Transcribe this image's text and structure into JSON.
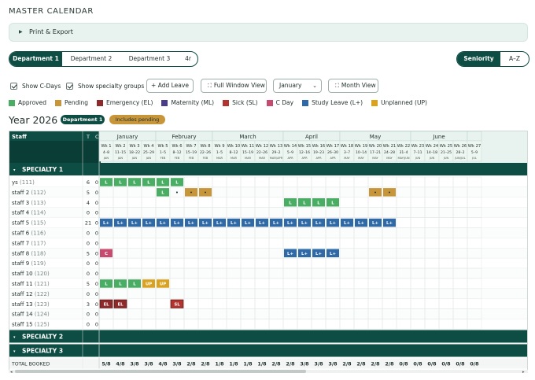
{
  "title": "MASTER CALENDAR",
  "print_export": "Print & Export",
  "dept_tabs": [
    "Department 1",
    "Department 2",
    "Department 3",
    "4r"
  ],
  "sort_tabs": [
    "Seniority",
    "A–Z"
  ],
  "controls": {
    "show_c_days": "Show C-Days",
    "show_specialty": "Show specialty groups",
    "add_leave": "+ Add Leave",
    "full_window": "Full Window View",
    "month_select": "January",
    "month_view": "Month View"
  },
  "legend": [
    {
      "label": "Approved",
      "color": "#4aad64"
    },
    {
      "label": "Pending",
      "color": "#c8963a"
    },
    {
      "label": "Emergency (EL)",
      "color": "#8e2a2a"
    },
    {
      "label": "Maternity (ML)",
      "color": "#4b3d8a"
    },
    {
      "label": "Sick (SL)",
      "color": "#b2342f"
    },
    {
      "label": "C Day",
      "color": "#c64b6e"
    },
    {
      "label": "Study Leave (L+)",
      "color": "#2f6aa7"
    },
    {
      "label": "Unplanned (UP)",
      "color": "#d9a21f"
    }
  ],
  "year_title": "Year 2026",
  "badge_dept": "Department 1",
  "badge_pending": "Includes pending",
  "table": {
    "staff_header": "Staff",
    "t_header": "T",
    "c_header": "C",
    "months": [
      {
        "name": "January",
        "start": 0,
        "span": 4
      },
      {
        "name": "February",
        "start": 4,
        "span": 4
      },
      {
        "name": "March",
        "start": 8,
        "span": 5
      },
      {
        "name": "April",
        "start": 13,
        "span": 4
      },
      {
        "name": "May",
        "start": 17,
        "span": 5
      },
      {
        "name": "June",
        "start": 22,
        "span": 4
      },
      {
        "name": "",
        "start": 26,
        "span": 1
      }
    ],
    "weeks": [
      {
        "wk": "Wk 1",
        "dates": "4–8",
        "mon": "JAN"
      },
      {
        "wk": "Wk 2",
        "dates": "11–15",
        "mon": "JAN"
      },
      {
        "wk": "Wk 3",
        "dates": "18–22",
        "mon": "JAN"
      },
      {
        "wk": "Wk 4",
        "dates": "25–29",
        "mon": "JAN"
      },
      {
        "wk": "Wk 5",
        "dates": "1–5",
        "mon": "FEB"
      },
      {
        "wk": "Wk 6",
        "dates": "8–12",
        "mon": "FEB"
      },
      {
        "wk": "Wk 7",
        "dates": "15–19",
        "mon": "FEB"
      },
      {
        "wk": "Wk 8",
        "dates": "22–26",
        "mon": "FEB"
      },
      {
        "wk": "Wk 9",
        "dates": "1–5",
        "mon": "MAR"
      },
      {
        "wk": "Wk 10",
        "dates": "8–12",
        "mon": "MAR"
      },
      {
        "wk": "Wk 11",
        "dates": "15–19",
        "mon": "MAR"
      },
      {
        "wk": "Wk 12",
        "dates": "22–26",
        "mon": "MAR"
      },
      {
        "wk": "Wk 13",
        "dates": "29–2",
        "mon": "MAR/APR"
      },
      {
        "wk": "Wk 14",
        "dates": "5–9",
        "mon": "APR"
      },
      {
        "wk": "Wk 15",
        "dates": "12–16",
        "mon": "APR"
      },
      {
        "wk": "Wk 16",
        "dates": "19–23",
        "mon": "APR"
      },
      {
        "wk": "Wk 17",
        "dates": "26–30",
        "mon": "APR"
      },
      {
        "wk": "Wk 18",
        "dates": "3–7",
        "mon": "MAY"
      },
      {
        "wk": "Wk 19",
        "dates": "10–14",
        "mon": "MAY"
      },
      {
        "wk": "Wk 20",
        "dates": "17–21",
        "mon": "MAY"
      },
      {
        "wk": "Wk 21",
        "dates": "24–28",
        "mon": "MAY"
      },
      {
        "wk": "Wk 22",
        "dates": "31–4",
        "mon": "MAY/JUN"
      },
      {
        "wk": "Wk 23",
        "dates": "7–11",
        "mon": "JUN"
      },
      {
        "wk": "Wk 24",
        "dates": "14–18",
        "mon": "JUN"
      },
      {
        "wk": "Wk 25",
        "dates": "21–25",
        "mon": "JUN"
      },
      {
        "wk": "Wk 26",
        "dates": "28–2",
        "mon": "JUN/JUL"
      },
      {
        "wk": "Wk 27",
        "dates": "5–9",
        "mon": "JUL"
      }
    ],
    "specialty_1": "SPECIALTY 1",
    "specialty_2": "SPECIALTY 2",
    "specialty_3": "SPECIALTY 3",
    "staff": [
      {
        "name": "ys",
        "id": "(111)",
        "t": "6",
        "c": "0",
        "cells": [
          {
            "w": 0,
            "k": "L",
            "c": "approved"
          },
          {
            "w": 1,
            "k": "L",
            "c": "approved"
          },
          {
            "w": 2,
            "k": "L",
            "c": "approved"
          },
          {
            "w": 3,
            "k": "L",
            "c": "approved"
          },
          {
            "w": 4,
            "k": "L",
            "c": "approved"
          },
          {
            "w": 5,
            "k": "L",
            "c": "approved"
          }
        ]
      },
      {
        "name": "staff 2",
        "id": "(112)",
        "t": "5",
        "c": "0",
        "cells": [
          {
            "w": 4,
            "k": "L",
            "c": "approved"
          },
          {
            "w": 5,
            "k": "•",
            "c": "dot"
          },
          {
            "w": 6,
            "k": "•",
            "c": "pending"
          },
          {
            "w": 7,
            "k": "•",
            "c": "pending"
          },
          {
            "w": 19,
            "k": "•",
            "c": "pending"
          },
          {
            "w": 20,
            "k": "•",
            "c": "pending"
          }
        ]
      },
      {
        "name": "staff 3",
        "id": "(113)",
        "t": "4",
        "c": "0",
        "cells": [
          {
            "w": 13,
            "k": "L",
            "c": "approved"
          },
          {
            "w": 14,
            "k": "L",
            "c": "approved"
          },
          {
            "w": 15,
            "k": "L",
            "c": "approved"
          },
          {
            "w": 16,
            "k": "L",
            "c": "approved"
          }
        ]
      },
      {
        "name": "staff 4",
        "id": "(114)",
        "t": "0",
        "c": "0",
        "cells": []
      },
      {
        "name": "staff 5",
        "id": "(115)",
        "t": "21",
        "c": "0",
        "cells": [
          {
            "w": 0,
            "k": "L+",
            "c": "study"
          },
          {
            "w": 1,
            "k": "L+",
            "c": "study"
          },
          {
            "w": 2,
            "k": "L+",
            "c": "study"
          },
          {
            "w": 3,
            "k": "L+",
            "c": "study"
          },
          {
            "w": 4,
            "k": "L+",
            "c": "study"
          },
          {
            "w": 5,
            "k": "L+",
            "c": "study"
          },
          {
            "w": 6,
            "k": "L+",
            "c": "study"
          },
          {
            "w": 7,
            "k": "L+",
            "c": "study"
          },
          {
            "w": 8,
            "k": "L+",
            "c": "study"
          },
          {
            "w": 9,
            "k": "L+",
            "c": "study"
          },
          {
            "w": 10,
            "k": "L+",
            "c": "study"
          },
          {
            "w": 11,
            "k": "L+",
            "c": "study"
          },
          {
            "w": 12,
            "k": "L+",
            "c": "study"
          },
          {
            "w": 13,
            "k": "L+",
            "c": "study"
          },
          {
            "w": 14,
            "k": "L+",
            "c": "study"
          },
          {
            "w": 15,
            "k": "L+",
            "c": "study"
          },
          {
            "w": 16,
            "k": "L+",
            "c": "study"
          },
          {
            "w": 17,
            "k": "L+",
            "c": "study"
          },
          {
            "w": 18,
            "k": "L+",
            "c": "study"
          },
          {
            "w": 19,
            "k": "L+",
            "c": "study"
          },
          {
            "w": 20,
            "k": "L+",
            "c": "study"
          }
        ]
      },
      {
        "name": "staff 6",
        "id": "(116)",
        "t": "0",
        "c": "0",
        "cells": []
      },
      {
        "name": "staff 7",
        "id": "(117)",
        "t": "0",
        "c": "0",
        "cells": []
      },
      {
        "name": "staff 8",
        "id": "(118)",
        "t": "5",
        "c": "0",
        "cells": [
          {
            "w": 0,
            "k": "C",
            "c": "cday"
          },
          {
            "w": 13,
            "k": "L+",
            "c": "study"
          },
          {
            "w": 14,
            "k": "L+",
            "c": "study"
          },
          {
            "w": 15,
            "k": "L+",
            "c": "study"
          },
          {
            "w": 16,
            "k": "L+",
            "c": "study"
          }
        ]
      },
      {
        "name": "staff 9",
        "id": "(119)",
        "t": "0",
        "c": "0",
        "cells": []
      },
      {
        "name": "staff 10",
        "id": "(120)",
        "t": "0",
        "c": "0",
        "cells": []
      },
      {
        "name": "staff 11",
        "id": "(121)",
        "t": "5",
        "c": "0",
        "cells": [
          {
            "w": 0,
            "k": "L",
            "c": "approved"
          },
          {
            "w": 1,
            "k": "L",
            "c": "approved"
          },
          {
            "w": 2,
            "k": "L",
            "c": "approved"
          },
          {
            "w": 3,
            "k": "UP",
            "c": "unplanned"
          },
          {
            "w": 4,
            "k": "UP",
            "c": "unplanned"
          }
        ]
      },
      {
        "name": "staff 12",
        "id": "(122)",
        "t": "0",
        "c": "0",
        "cells": []
      },
      {
        "name": "staff 13",
        "id": "(123)",
        "t": "3",
        "c": "0",
        "cells": [
          {
            "w": 0,
            "k": "EL",
            "c": "emergency"
          },
          {
            "w": 1,
            "k": "EL",
            "c": "emergency"
          },
          {
            "w": 5,
            "k": "SL",
            "c": "sick"
          }
        ]
      },
      {
        "name": "staff 14",
        "id": "(124)",
        "t": "0",
        "c": "0",
        "cells": []
      },
      {
        "name": "staff 15",
        "id": "(125)",
        "t": "0",
        "c": "0",
        "cells": []
      }
    ],
    "total_label": "TOTAL BOOKED",
    "totals": [
      "5/8",
      "4/8",
      "3/8",
      "3/8",
      "4/8",
      "3/8",
      "2/8",
      "2/8",
      "1/8",
      "1/8",
      "1/8",
      "1/8",
      "2/8",
      "2/8",
      "3/8",
      "3/8",
      "3/8",
      "2/8",
      "2/8",
      "2/8",
      "2/8",
      "0/8",
      "0/8",
      "0/8",
      "0/8",
      "0/8",
      "0/8"
    ]
  }
}
